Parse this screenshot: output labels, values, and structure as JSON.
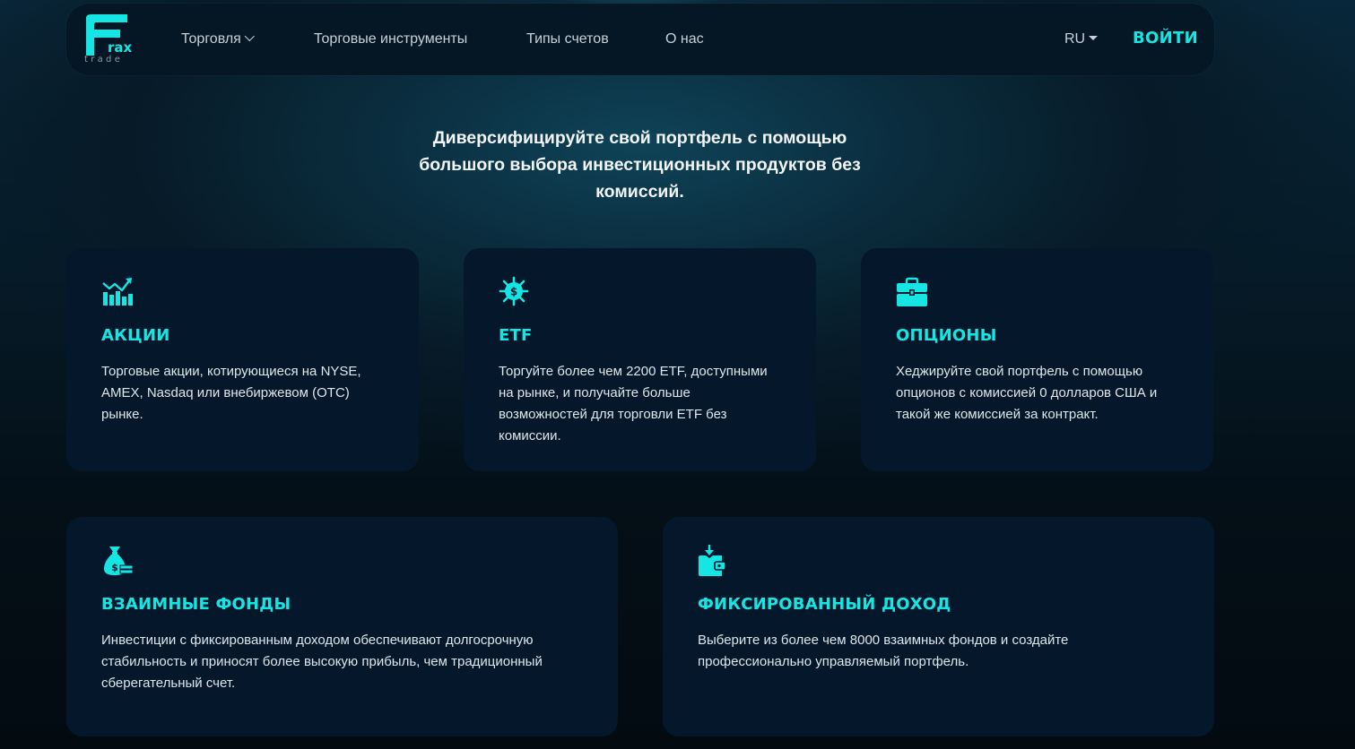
{
  "brand": {
    "logo_letter": "F",
    "logo_rax": "rax",
    "logo_sub": "trade",
    "accent_color": "#16e6e3"
  },
  "nav": {
    "items": [
      {
        "label": "Торговля",
        "has_dropdown": true
      },
      {
        "label": "Торговые инструменты"
      },
      {
        "label": "Типы счетов"
      },
      {
        "label": "О нас"
      }
    ],
    "language": "RU",
    "login_label": "ВОЙТИ"
  },
  "hero": {
    "text": "Диверсифицируйте свой портфель с помощью большого выбора инвестиционных продуктов без комиссий."
  },
  "cards": [
    {
      "icon": "stocks-chart-icon",
      "title": "АКЦИИ",
      "text": "Торговые акции, котирующиеся на NYSE, AMEX, Nasdaq или внебиржевом (OTC) рынке."
    },
    {
      "icon": "gear-dollar-icon",
      "title": "ETF",
      "text": "Торгуйте более чем 2200 ETF, доступными на рынке, и получайте больше возможностей для торговли ETF без комиссии."
    },
    {
      "icon": "briefcase-icon",
      "title": "ОПЦИОНЫ",
      "text": "Хеджируйте свой портфель с помощью опционов с комиссией 0 долларов США и такой же комиссией за контракт."
    },
    {
      "icon": "money-bag-icon",
      "title": "ВЗАИМНЫЕ ФОНДЫ",
      "text": "Инвестиции с фиксированным доходом обеспечивают долгосрочную стабильность и приносят более высокую прибыль, чем традиционный сберегательный счет."
    },
    {
      "icon": "wallet-arrow-icon",
      "title": "ФИКСИРОВАННЫЙ ДОХОД",
      "text": "Выберите из более чем 8000 взаимных фондов и создайте профессионально управляемый портфель."
    }
  ]
}
